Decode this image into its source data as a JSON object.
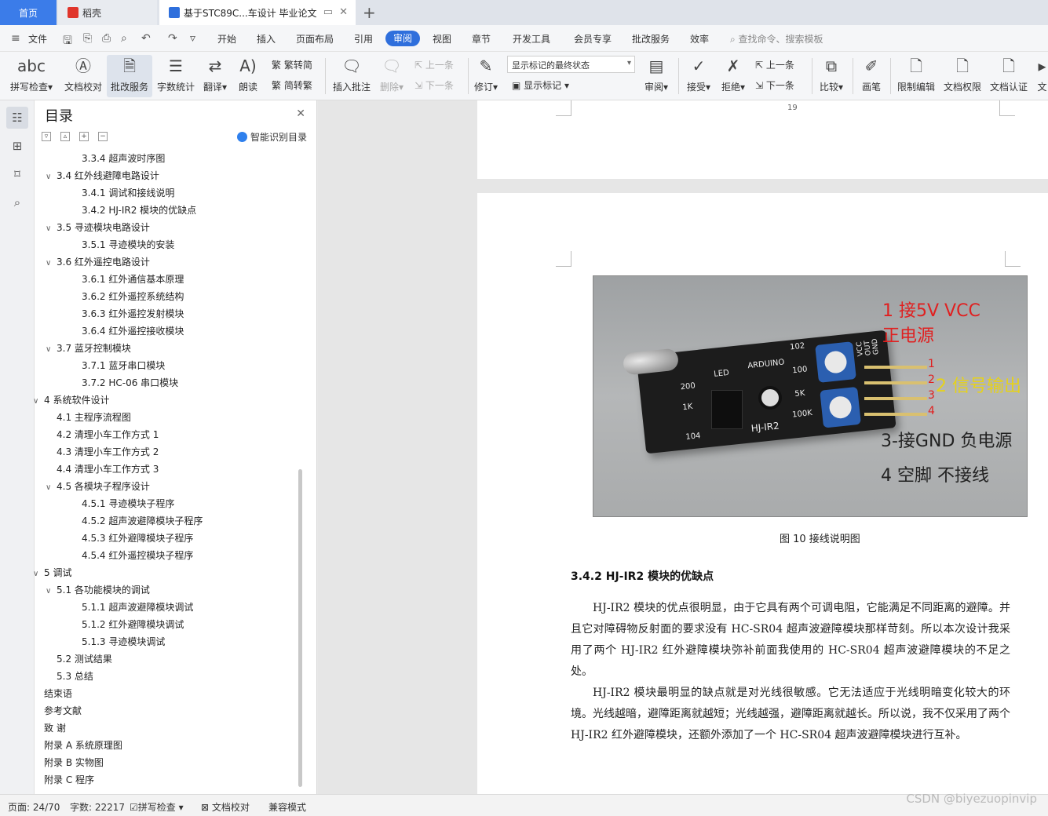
{
  "tabs": {
    "home": "首页",
    "daoke": "稻壳",
    "doc": "基于STC89C...车设计 毕业论文"
  },
  "menu": {
    "file": "文件",
    "items": [
      "开始",
      "插入",
      "页面布局",
      "引用",
      "审阅",
      "视图",
      "章节",
      "开发工具",
      "会员专享",
      "批改服务",
      "效率"
    ],
    "active": "审阅",
    "search": "查找命令、搜索模板"
  },
  "ribbon": {
    "spell": "拼写检查",
    "proof": "文档校对",
    "correct": "批改服务",
    "wordcount": "字数统计",
    "translate": "翻译",
    "read": "朗读",
    "trad": "繁转简",
    "simp": "简转繁",
    "insert_comment": "插入批注",
    "delete": "删除",
    "prev_comment": "上一条",
    "next_comment": "下一条",
    "track": "修订",
    "markup_state": "显示标记的最终状态",
    "show_markup": "显示标记",
    "review": "审阅",
    "accept": "接受",
    "reject": "拒绝",
    "prev": "上一条",
    "next": "下一条",
    "compare": "比较",
    "pen": "画笔",
    "restrict": "限制编辑",
    "permission": "文档权限",
    "certify": "文档认证",
    "more": "文"
  },
  "toc": {
    "title": "目录",
    "smart": "智能识别目录",
    "items": [
      {
        "text": "3.3.4  超声波时序图",
        "level": 3,
        "arrow": ""
      },
      {
        "text": "3.4  红外线避障电路设计",
        "level": 2,
        "arrow": "∨"
      },
      {
        "text": "3.4.1  调试和接线说明",
        "level": 3,
        "arrow": ""
      },
      {
        "text": "3.4.2 HJ-IR2 模块的优缺点",
        "level": 3,
        "arrow": ""
      },
      {
        "text": "3.5  寻迹模块电路设计",
        "level": 2,
        "arrow": "∨"
      },
      {
        "text": "3.5.1  寻迹模块的安装",
        "level": 3,
        "arrow": ""
      },
      {
        "text": "3.6  红外遥控电路设计",
        "level": 2,
        "arrow": "∨"
      },
      {
        "text": "3.6.1  红外通信基本原理",
        "level": 3,
        "arrow": ""
      },
      {
        "text": "3.6.2  红外遥控系统结构",
        "level": 3,
        "arrow": ""
      },
      {
        "text": "3.6.3  红外遥控发射模块",
        "level": 3,
        "arrow": ""
      },
      {
        "text": "3.6.4  红外遥控接收模块",
        "level": 3,
        "arrow": ""
      },
      {
        "text": "3.7  蓝牙控制模块",
        "level": 2,
        "arrow": "∨"
      },
      {
        "text": "3.7.1  蓝牙串口模块",
        "level": 3,
        "arrow": ""
      },
      {
        "text": "3.7.2 HC-06 串口模块",
        "level": 3,
        "arrow": ""
      },
      {
        "text": "4  系统软件设计",
        "level": 1,
        "arrow": "∨"
      },
      {
        "text": "4.1  主程序流程图",
        "level": 2,
        "arrow": ""
      },
      {
        "text": "4.2  清理小车工作方式 1",
        "level": 2,
        "arrow": ""
      },
      {
        "text": "4.3  清理小车工作方式 2",
        "level": 2,
        "arrow": ""
      },
      {
        "text": "4.4  清理小车工作方式 3",
        "level": 2,
        "arrow": ""
      },
      {
        "text": "4.5  各模块子程序设计",
        "level": 2,
        "arrow": "∨"
      },
      {
        "text": "4.5.1  寻迹模块子程序",
        "level": 3,
        "arrow": ""
      },
      {
        "text": "4.5.2  超声波避障模块子程序",
        "level": 3,
        "arrow": ""
      },
      {
        "text": "4.5.3  红外避障模块子程序",
        "level": 3,
        "arrow": ""
      },
      {
        "text": "4.5.4  红外遥控模块子程序",
        "level": 3,
        "arrow": ""
      },
      {
        "text": "5  调试",
        "level": 1,
        "arrow": "∨"
      },
      {
        "text": "5.1  各功能模块的调试",
        "level": 2,
        "arrow": "∨"
      },
      {
        "text": "5.1.1  超声波避障模块调试",
        "level": 3,
        "arrow": ""
      },
      {
        "text": "5.1.2  红外避障模块调试",
        "level": 3,
        "arrow": ""
      },
      {
        "text": "5.1.3  寻迹模块调试",
        "level": 3,
        "arrow": ""
      },
      {
        "text": "5.2  测试结果",
        "level": 2,
        "arrow": ""
      },
      {
        "text": "5.3  总结",
        "level": 2,
        "arrow": ""
      },
      {
        "text": "结束语",
        "level": 1,
        "arrow": ""
      },
      {
        "text": "参考文献",
        "level": 1,
        "arrow": ""
      },
      {
        "text": "致    谢",
        "level": 1,
        "arrow": ""
      },
      {
        "text": "附录 A    系统原理图",
        "level": 1,
        "arrow": ""
      },
      {
        "text": "附录 B    实物图",
        "level": 1,
        "arrow": ""
      },
      {
        "text": "附录 C    程序",
        "level": 1,
        "arrow": ""
      }
    ]
  },
  "document": {
    "page_number": "19",
    "figure": {
      "label1": "1 接5V VCC",
      "label1b": "正电源",
      "label2": "2 信号输出",
      "label3": "3-接GND 负电源",
      "label4": "4 空脚 不接线",
      "pin_numbers": [
        "1",
        "2",
        "3",
        "4"
      ],
      "board_name": "HJ-IR2",
      "board_arduino": "ARDUINO",
      "board_led": "LED",
      "board_side": "VCC OUT GND",
      "board_codes": [
        "102",
        "100",
        "5K",
        "100K",
        "1K",
        "200",
        "104"
      ]
    },
    "caption": "图 10  接线说明图",
    "heading": "3.4.2  HJ-IR2 模块的优缺点",
    "para1": "HJ-IR2 模块的优点很明显，由于它具有两个可调电阻，它能满足不同距离的避障。并且它对障碍物反射面的要求没有 HC-SR04 超声波避障模块那样苛刻。所以本次设计我采用了两个 HJ-IR2 红外避障模块弥补前面我使用的 HC-SR04 超声波避障模块的不足之处。",
    "para2": "HJ-IR2 模块最明显的缺点就是对光线很敏感。它无法适应于光线明暗变化较大的环境。光线越暗，避障距离就越短；光线越强，避障距离就越长。所以说，我不仅采用了两个 HJ-IR2 红外避障模块，还额外添加了一个 HC-SR04 超声波避障模块进行互补。"
  },
  "status": {
    "page": "页面: 24/70",
    "words": "字数: 22217",
    "spell": "拼写检查",
    "proof": "文档校对",
    "compat": "兼容模式"
  },
  "watermark": "CSDN @biyezuopinvip"
}
